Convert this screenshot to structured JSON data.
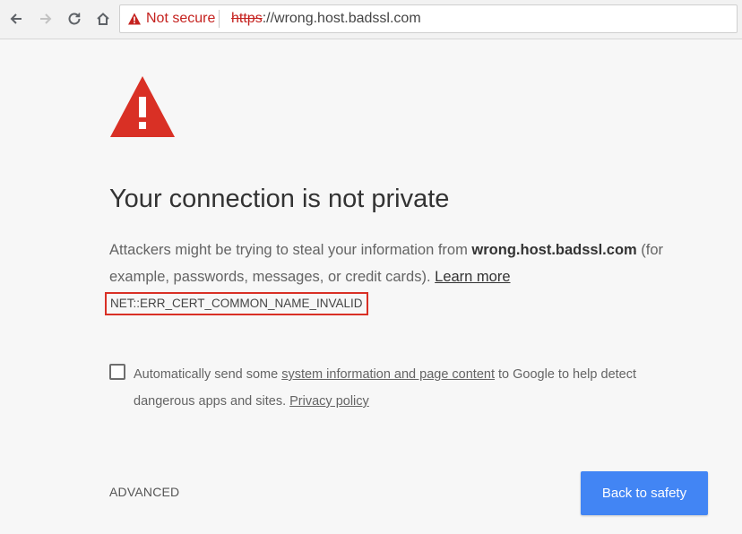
{
  "toolbar": {
    "security_label": "Not secure",
    "url_scheme": "https",
    "url_rest": "://wrong.host.badssl.com"
  },
  "icons": [
    "back-arrow-icon",
    "forward-arrow-icon",
    "reload-icon",
    "home-icon",
    "warning-triangle-icon",
    "alert-triangle-icon"
  ],
  "colors": {
    "danger": "#c5221f",
    "warning_icon": "#d93025",
    "primary_button": "#4285f4",
    "page_bg": "#f7f7f7"
  },
  "main": {
    "heading": "Your connection is not private",
    "para_prefix": "Attackers might be trying to steal your information from ",
    "host": "wrong.host.badssl.com",
    "para_suffix": " (for example, passwords, messages, or credit cards). ",
    "learn_more": "Learn more",
    "error_code": "NET::ERR_CERT_COMMON_NAME_INVALID"
  },
  "optin": {
    "checked": false,
    "text_prefix": "Automatically send some ",
    "link1": "system information and page content",
    "text_mid": " to Google to help detect dangerous apps and sites. ",
    "link2": "Privacy policy"
  },
  "actions": {
    "advanced": "ADVANCED",
    "back_to_safety": "Back to safety"
  }
}
